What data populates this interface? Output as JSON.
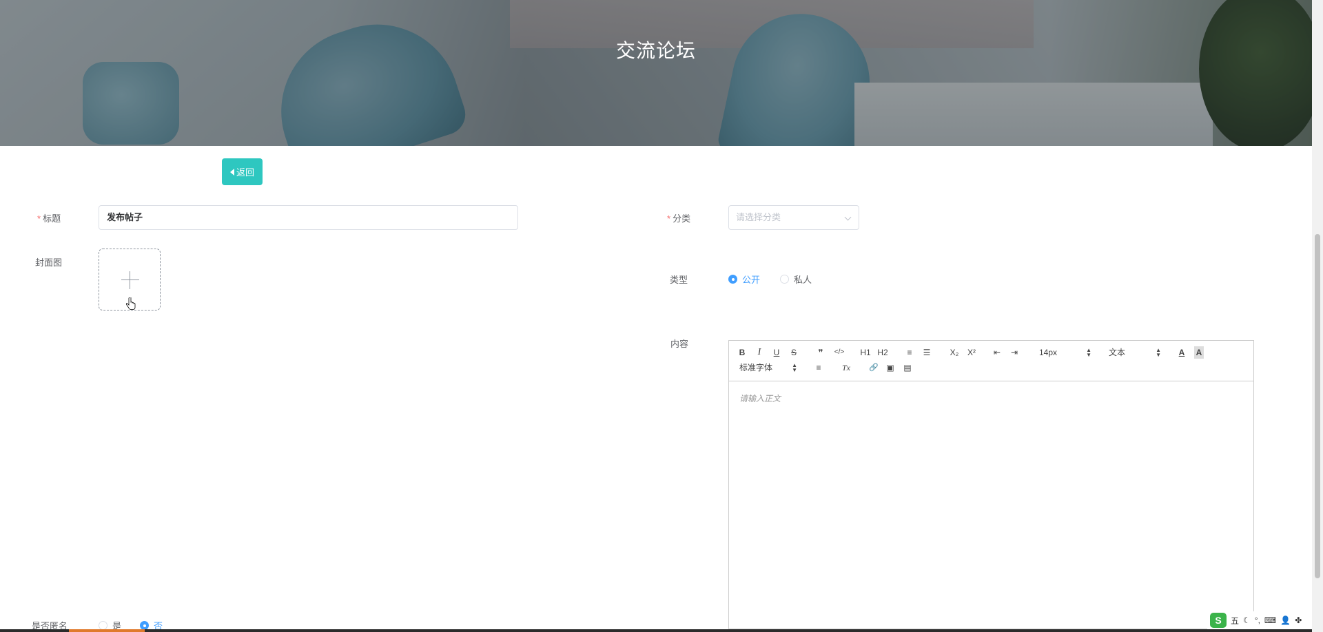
{
  "banner": {
    "title": "交流论坛"
  },
  "back_button": {
    "label": "返回"
  },
  "form": {
    "title": {
      "required_mark": "*",
      "label": "标题",
      "value": "发布帖子"
    },
    "category": {
      "required_mark": "*",
      "label": "分类",
      "placeholder": "请选择分类"
    },
    "cover": {
      "label": "封面图"
    },
    "type": {
      "label": "类型",
      "options": [
        "公开",
        "私人"
      ],
      "selected": "公开"
    },
    "content": {
      "label": "内容",
      "placeholder": "请输入正文"
    },
    "anonymous": {
      "label": "是否匿名",
      "options": [
        "是",
        "否"
      ],
      "selected": "否"
    }
  },
  "editor_toolbar": {
    "bold": "B",
    "italic": "I",
    "underline": "U",
    "strike": "S",
    "quote": "❞",
    "code": "</>",
    "h1": "H1",
    "h2": "H2",
    "ordered_list": "≡",
    "bullet_list": "☰",
    "subscript": "X₂",
    "superscript": "X²",
    "outdent": "⇤",
    "indent": "⇥",
    "size": "14px",
    "header": "文本",
    "font": "标准字体",
    "color": "A",
    "background": "A",
    "align": "≡",
    "clean": "Tx",
    "link": "🔗",
    "image": "▣",
    "video": "▤"
  },
  "ime": {
    "logo": "S",
    "mode": "五",
    "moon": "☾",
    "punct": "°,",
    "keyboard": "⌨",
    "user": "👤",
    "apps": "✤"
  },
  "colors": {
    "accent": "#2ec7c0",
    "primary": "#409eff",
    "required": "#f56c6c"
  }
}
